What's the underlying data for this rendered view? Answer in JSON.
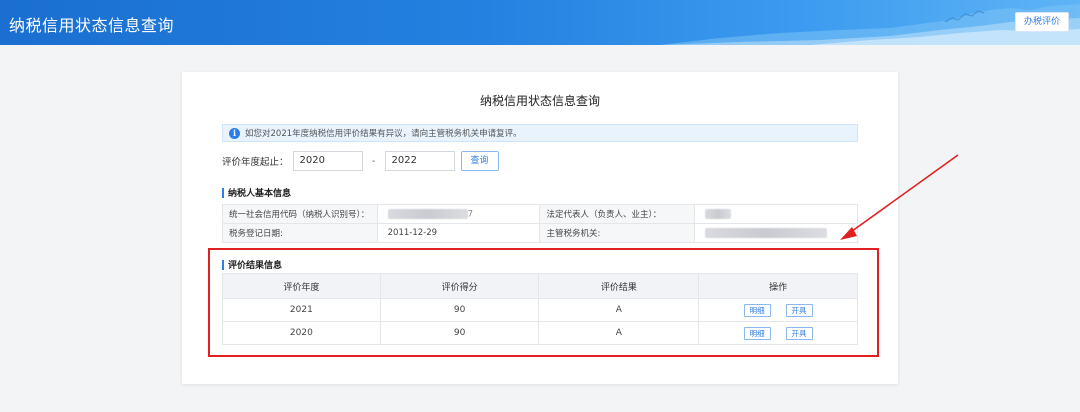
{
  "header": {
    "title": "纳税信用状态信息查询",
    "eval_button": "办税评价"
  },
  "page": {
    "title": "纳税信用状态信息查询",
    "notice": "如您对2021年度纳税信用评价结果有异议，请向主管税务机关申请复评。",
    "notice_icon": "info-icon"
  },
  "query": {
    "label": "评价年度起止：",
    "start_year": "2020",
    "separator": "-",
    "end_year": "2022",
    "button": "查询"
  },
  "basic_info": {
    "title": "纳税人基本信息",
    "rows": [
      {
        "label1": "统一社会信用代码（纳税人识别号）：",
        "value1": "7",
        "label2": "法定代表人（负责人、业主）：",
        "value2": ""
      },
      {
        "label1": "税务登记日期:",
        "value1": "2011-12-29",
        "label2": "主管税务机关:",
        "value2": ""
      }
    ]
  },
  "result": {
    "title": "评价结果信息",
    "columns": [
      "评价年度",
      "评价得分",
      "评价结果",
      "操作"
    ],
    "rows": [
      {
        "year": "2021",
        "score": "90",
        "grade": "A"
      },
      {
        "year": "2020",
        "score": "90",
        "grade": "A"
      }
    ],
    "detail_button": "明细",
    "issue_button": "开具"
  },
  "colors": {
    "header_blue": "#2481e0",
    "accent": "#2b7de9",
    "annotation_red": "#e02020"
  }
}
